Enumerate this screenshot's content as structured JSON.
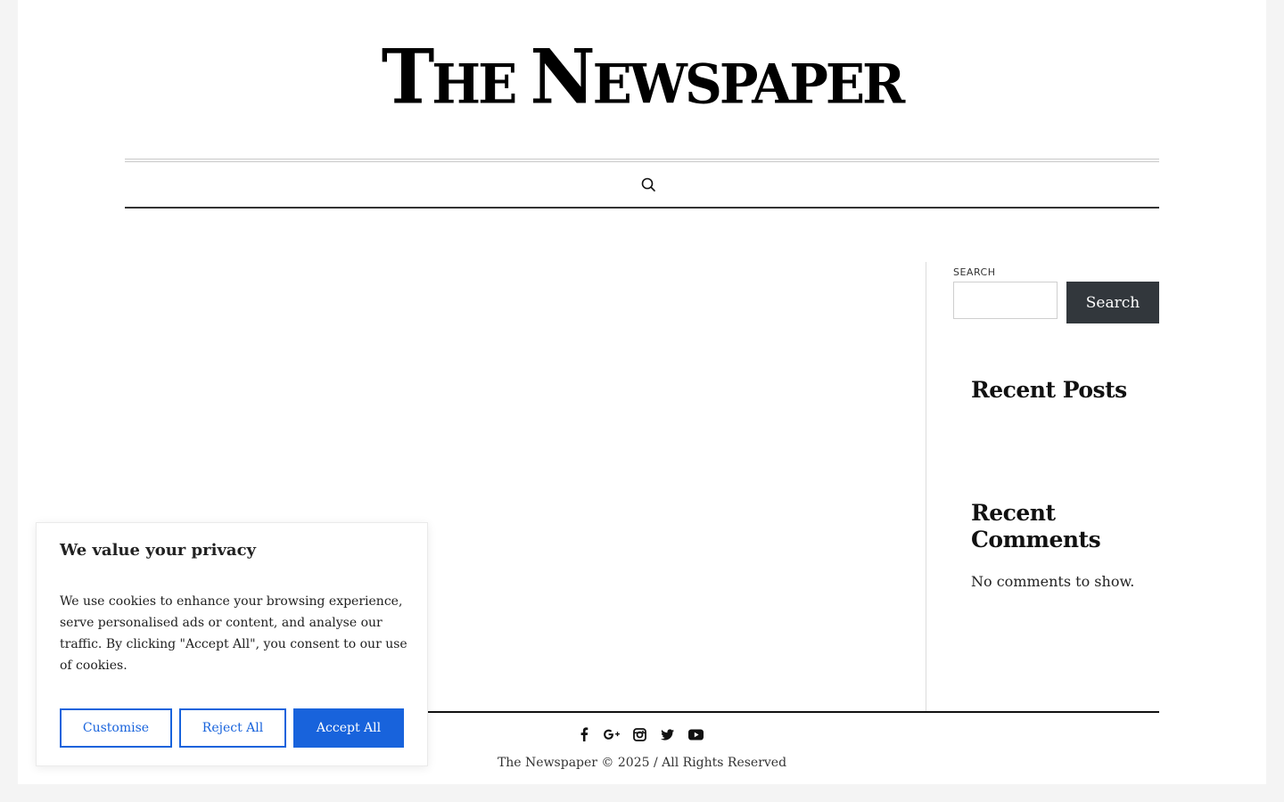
{
  "site": {
    "masthead": {
      "parts": [
        {
          "text": "T",
          "size": "big"
        },
        {
          "text": "HE ",
          "size": "small"
        },
        {
          "text": "N",
          "size": "big"
        },
        {
          "text": "EWSPAPER",
          "size": "small"
        }
      ]
    }
  },
  "nav": {
    "search_icon": "search-icon"
  },
  "sidebar": {
    "search": {
      "label": "SEARCH",
      "input_value": "",
      "button_label": "Search"
    },
    "recent_posts": {
      "title": "Recent Posts"
    },
    "recent_comments": {
      "title": "Recent Comments",
      "empty_text": "No comments to show."
    }
  },
  "footer": {
    "social_icons": [
      "facebook-icon",
      "google-plus-icon",
      "instagram-icon",
      "twitter-icon",
      "youtube-icon"
    ],
    "copyright": "The Newspaper © 2025 / All Rights Reserved"
  },
  "cookie_banner": {
    "title": "We value your privacy",
    "text": "We use cookies to enhance your browsing experience, serve personalised ads or content, and analyse our traffic. By clicking \"Accept All\", you consent to our use of cookies.",
    "buttons": {
      "customise": "Customise",
      "reject": "Reject All",
      "accept": "Accept All"
    },
    "colors": {
      "accent": "#1863dc",
      "text": "#212121"
    }
  },
  "colors": {
    "page_bg": "#f4f4f4",
    "content_bg": "#ffffff",
    "search_button_bg": "#32373c",
    "rule_dark": "#333333"
  }
}
